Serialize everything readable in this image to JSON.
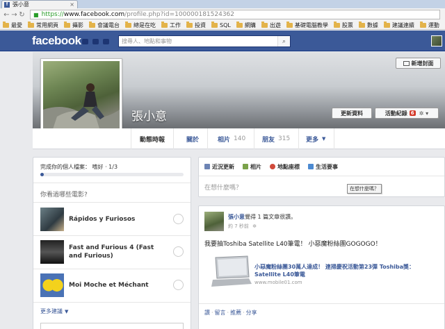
{
  "browser": {
    "tab_title": "張小意",
    "tab_favicon": "f",
    "url_scheme": "https://",
    "url_host": "www.facebook.com",
    "url_path": "/profile.php?id=100000181524362",
    "bookmarks": [
      "最愛",
      "常用網頁",
      "攝影",
      "會議電台",
      "總是在吃",
      "工作",
      "投資",
      "SQL",
      "網購",
      "出遊",
      "基礎電腦教學",
      "股票",
      "數據",
      "建議連續",
      "運動"
    ]
  },
  "facebook": {
    "logo": "facebook",
    "search_placeholder": "搜尋人、地點和事物"
  },
  "profile": {
    "name": "張小意",
    "add_cover_label": "新增封面",
    "update_info_label": "更新資料",
    "activity_log_label": "活動紀錄",
    "activity_badge": "6",
    "nav": {
      "timeline": "動態時報",
      "about": "關於",
      "photos": "相片",
      "photos_count": "140",
      "friends": "朋友",
      "friends_count": "315",
      "more": "更多"
    }
  },
  "left_panel": {
    "completion_text": "完成你的個人檔案： 嗜好 · 1/3",
    "completion_fraction": 0.025,
    "movie_question": "你看過哪些電影?",
    "movies": [
      {
        "title": "Rápidos y Furiosos"
      },
      {
        "title": "Fast and Furious 4 (Fast and Furious)"
      },
      {
        "title": "Moi Moche et Méchant"
      }
    ],
    "more_suggestions": "更多建議"
  },
  "composer": {
    "tabs": [
      "近況更新",
      "相片",
      "地點座標",
      "生活要事"
    ],
    "placeholder": "在想什麼嗎？",
    "tooltip": "在想什麼嗎？"
  },
  "post": {
    "author": "張小意",
    "action_text": "覺得 1 篇文章很讚。",
    "time": "約 7 秒前",
    "body": "我要抽Toshiba Satellite L40筆電！ 小惡魔粉絲團GOGOGO！",
    "link_title": "小惡魔粉絲團30萬人達成！ 連掃慶祝活動第23彈 Toshiba獎：Satellite L40筆電",
    "link_domain": "www.mobile01.com",
    "actions": [
      "讚",
      "留言",
      "推薦",
      "分享"
    ]
  },
  "colors": {
    "brand": "#3b5998",
    "badge": "#d43a2b"
  }
}
